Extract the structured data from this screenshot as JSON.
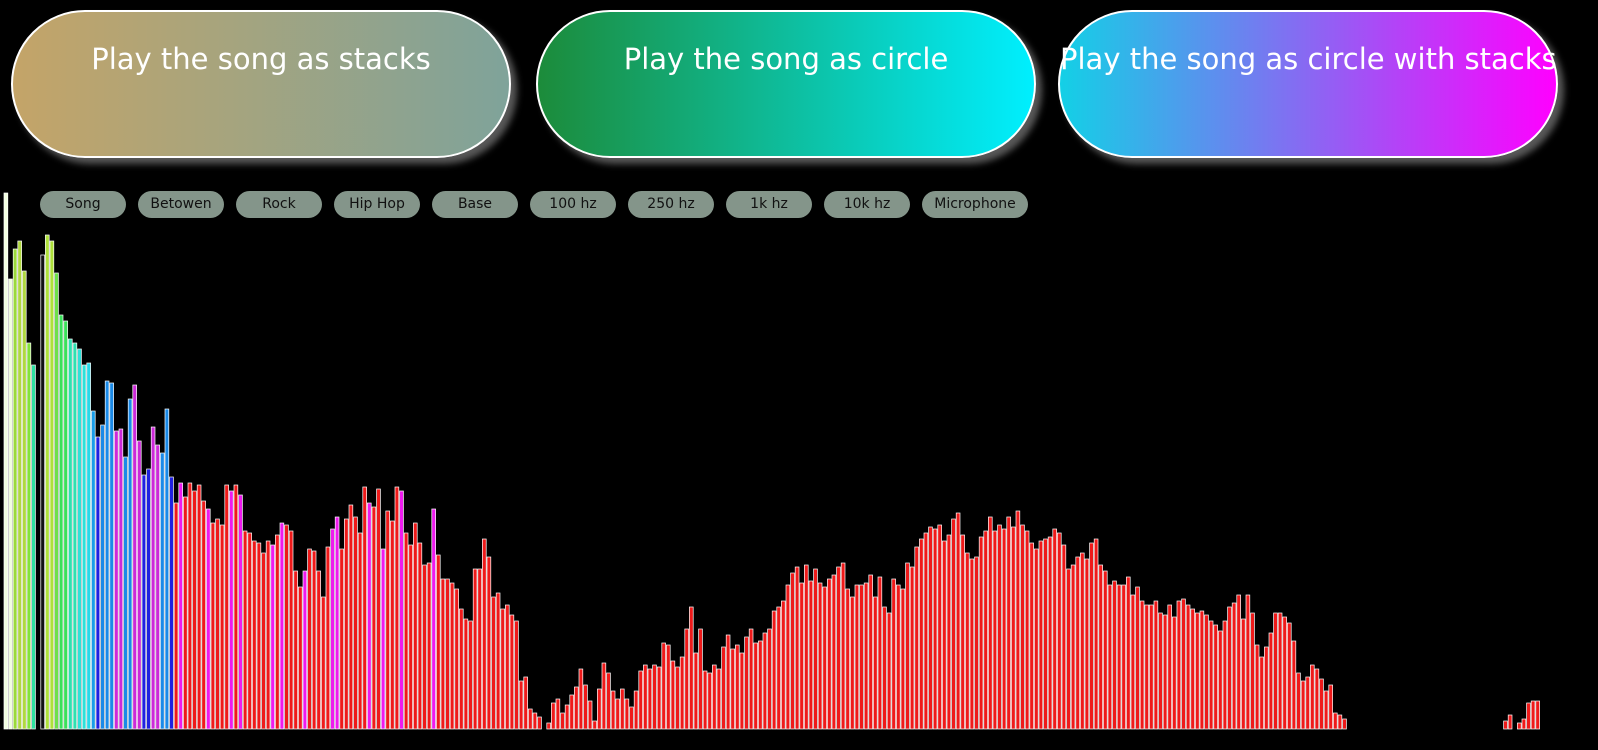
{
  "buttons": [
    {
      "label": "Play the song as stacks",
      "gradient": [
        "#c4a468",
        "#7fa39a"
      ]
    },
    {
      "label": "Play the song as circle",
      "gradient": [
        "#1c8b3a",
        "#00efff"
      ]
    },
    {
      "label": "Play the song as circle with stacks",
      "gradient": [
        "#13d0e6",
        "#ff00ff"
      ]
    }
  ],
  "presets": [
    "Song",
    "Betowen",
    "Rock",
    "Hip Hop",
    "Base",
    "100 hz",
    "250 hz",
    "1k hz",
    "10k hz",
    "Microphone"
  ],
  "colors": {
    "background": "#000000",
    "pill_bg": "#84958a",
    "bar_outline": "#ffffff"
  },
  "spectrum": {
    "max_level": 540,
    "levels": [
      536,
      450,
      480,
      488,
      458,
      386,
      364,
      0,
      474,
      494,
      488,
      456,
      414,
      408,
      390,
      386,
      380,
      364,
      366,
      318,
      292,
      304,
      348,
      346,
      298,
      300,
      272,
      330,
      344,
      288,
      254,
      260,
      302,
      284,
      276,
      320,
      252,
      226,
      246,
      232,
      246,
      238,
      244,
      228,
      220,
      206,
      210,
      204,
      244,
      238,
      244,
      234,
      198,
      196,
      188,
      186,
      176,
      188,
      184,
      194,
      206,
      204,
      198,
      158,
      142,
      158,
      180,
      178,
      158,
      132,
      182,
      200,
      212,
      180,
      210,
      224,
      212,
      196,
      242,
      226,
      222,
      240,
      180,
      218,
      208,
      242,
      238,
      196,
      184,
      206,
      186,
      164,
      166,
      220,
      174,
      150,
      150,
      146,
      140,
      120,
      110,
      108,
      160,
      160,
      190,
      172,
      132,
      136,
      120,
      124,
      114,
      108,
      48,
      52,
      20,
      16,
      12,
      0,
      6,
      26,
      30,
      16,
      24,
      34,
      42,
      60,
      44,
      28,
      8,
      40,
      66,
      56,
      38,
      30,
      40,
      30,
      22,
      38,
      58,
      64,
      60,
      64,
      62,
      86,
      84,
      68,
      62,
      72,
      100,
      122,
      76,
      100,
      58,
      56,
      64,
      60,
      82,
      94,
      80,
      84,
      76,
      92,
      100,
      86,
      88,
      96,
      100,
      118,
      122,
      128,
      144,
      156,
      162,
      146,
      164,
      148,
      160,
      146,
      142,
      150,
      154,
      162,
      166,
      140,
      132,
      144,
      144,
      146,
      154,
      132,
      152,
      122,
      116,
      150,
      144,
      140,
      166,
      162,
      182,
      190,
      196,
      202,
      200,
      204,
      188,
      194,
      210,
      216,
      194,
      176,
      170,
      172,
      192,
      198,
      212,
      198,
      204,
      200,
      212,
      202,
      218,
      204,
      198,
      186,
      180,
      188,
      190,
      192,
      200,
      196,
      184,
      160,
      164,
      172,
      176,
      170,
      186,
      190,
      164,
      158,
      144,
      148,
      144,
      144,
      152,
      134,
      142,
      128,
      124,
      124,
      128,
      116,
      114,
      124,
      112,
      128,
      130,
      124,
      120,
      116,
      118,
      114,
      108,
      104,
      98,
      108,
      122,
      126,
      134,
      110,
      134,
      116,
      84,
      72,
      82,
      96,
      116,
      116,
      112,
      106,
      88,
      56,
      48,
      52,
      64,
      60,
      50,
      38,
      44,
      16,
      14,
      10,
      0,
      0,
      0,
      0,
      0,
      0,
      0,
      0,
      0,
      0,
      0,
      0,
      0,
      0,
      0,
      0,
      0,
      0,
      0,
      0,
      0,
      0,
      0,
      0,
      0,
      0,
      0,
      0,
      0,
      0,
      0,
      0,
      0,
      0,
      8,
      14,
      0,
      6,
      10,
      26,
      28,
      28,
      0
    ],
    "palette": [
      "#f2ffe0",
      "#f2ffe0",
      "#9ad93a",
      "#b0d840",
      "#b0d840",
      "#84e23a",
      "#2ee2a0",
      "#2ee2a0",
      "#111111",
      "#aee03a",
      "#aee03a",
      "#6ee04a",
      "#3ae05a",
      "#3ae05a",
      "#2ee0b0",
      "#2ee0b0",
      "#2ee0d8",
      "#2ee0d8",
      "#28d8e8",
      "#1a9ee8",
      "#2020e0",
      "#1a8ae8",
      "#1a8ae8",
      "#1a8ae8",
      "#cc2ad8",
      "#cc2ad8",
      "#1a8ae8",
      "#1a8ae8",
      "#cc2ad8",
      "#cc2ad8",
      "#2020e0",
      "#2020e0",
      "#cc2ad8",
      "#cc2ad8",
      "#1a8ae8",
      "#1a8ae8",
      "#2020e0"
    ],
    "bar_color_default": "#ee1a1a",
    "bar_color_magenta": "#ee1aee"
  }
}
